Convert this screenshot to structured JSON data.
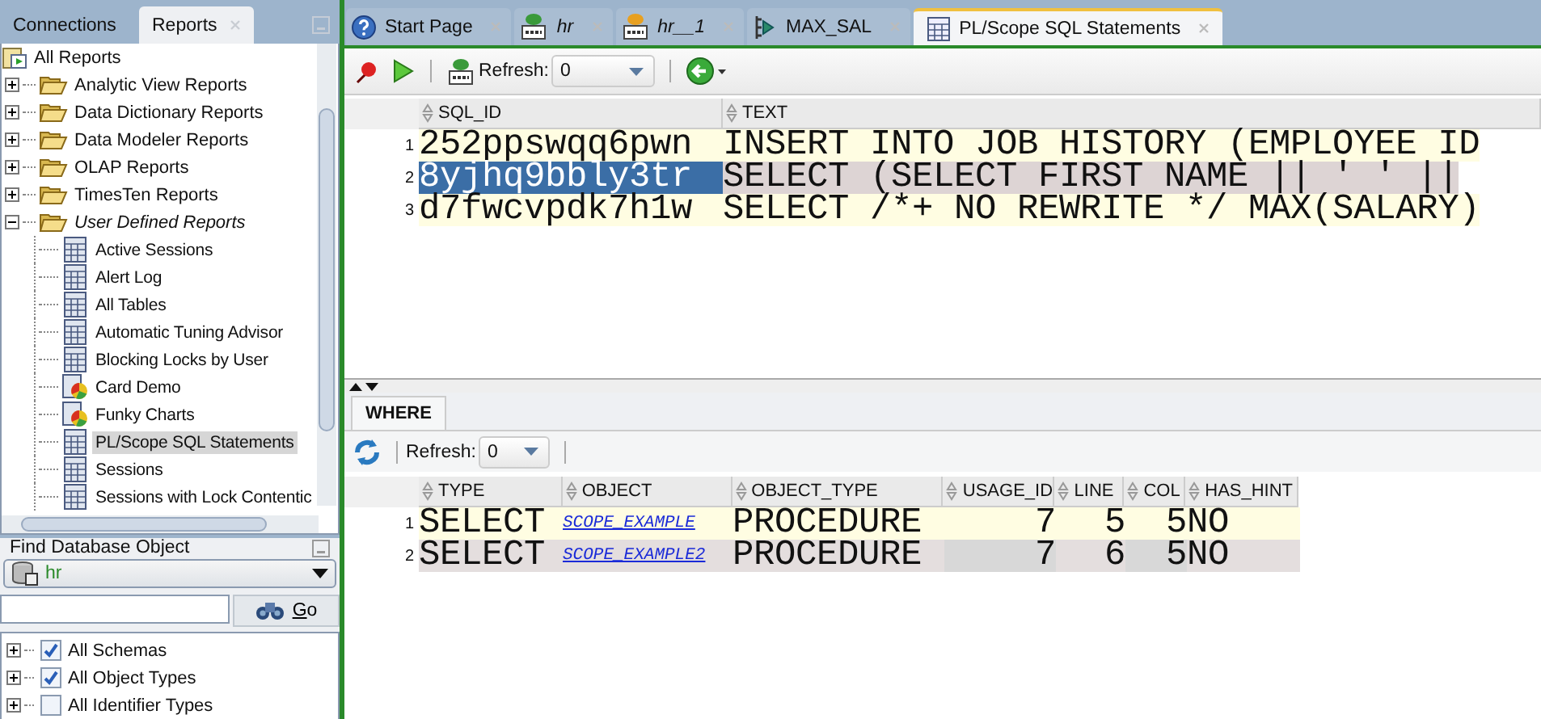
{
  "left_tabs": [
    {
      "label": "Connections",
      "selected": false
    },
    {
      "label": "Reports",
      "selected": true
    }
  ],
  "report_tree": {
    "label": "All Reports",
    "children": [
      {
        "label": "Analytic View Reports",
        "kind": "folder",
        "expanded": false,
        "emphasized": false
      },
      {
        "label": "Data Dictionary Reports",
        "kind": "folder",
        "expanded": false,
        "emphasized": false
      },
      {
        "label": "Data Modeler Reports",
        "kind": "folder",
        "expanded": false,
        "emphasized": false
      },
      {
        "label": "OLAP Reports",
        "kind": "folder",
        "expanded": false,
        "emphasized": false
      },
      {
        "label": "TimesTen Reports",
        "kind": "folder",
        "expanded": false,
        "emphasized": false
      },
      {
        "label": "User Defined Reports",
        "kind": "folder",
        "expanded": true,
        "emphasized": true,
        "children": [
          {
            "label": "Active Sessions",
            "kind": "table",
            "selected": false
          },
          {
            "label": "Alert Log",
            "kind": "table",
            "selected": false
          },
          {
            "label": "All Tables",
            "kind": "table",
            "selected": false
          },
          {
            "label": "Automatic Tuning Advisor",
            "kind": "table",
            "selected": false
          },
          {
            "label": "Blocking Locks by User",
            "kind": "table",
            "selected": false
          },
          {
            "label": "Card Demo",
            "kind": "chart",
            "selected": false
          },
          {
            "label": "Funky Charts",
            "kind": "chart",
            "selected": false
          },
          {
            "label": "PL/Scope SQL Statements",
            "kind": "table",
            "selected": true
          },
          {
            "label": "Sessions",
            "kind": "table",
            "selected": false
          },
          {
            "label": "Sessions with Lock Contentic",
            "kind": "table",
            "selected": false
          }
        ]
      }
    ]
  },
  "find_panel": {
    "title": "Find Database Object",
    "connection": "hr",
    "go_button": "Go",
    "filters": [
      {
        "label": "All Schemas",
        "checked": true
      },
      {
        "label": "All Object Types",
        "checked": true
      },
      {
        "label": "All Identifier Types",
        "checked": false
      }
    ]
  },
  "editor_tabs": [
    {
      "label": "Start Page",
      "kind": "help",
      "italic": false,
      "selected": false
    },
    {
      "label": "hr",
      "kind": "sql",
      "italic": true,
      "selected": false
    },
    {
      "label": "hr__1",
      "kind": "sql-new",
      "italic": true,
      "selected": false
    },
    {
      "label": "MAX_SAL",
      "kind": "procedure",
      "italic": false,
      "selected": false
    },
    {
      "label": "PL/Scope SQL Statements",
      "kind": "report",
      "italic": false,
      "selected": true
    }
  ],
  "toolbar": {
    "refresh_label": "Refresh:",
    "refresh_value": "0"
  },
  "statements": {
    "columns": [
      "SQL_ID",
      "TEXT"
    ],
    "rows": [
      {
        "number": "1",
        "selected": false,
        "cells": [
          "252ppswqq6pwn",
          "INSERT INTO JOB HISTORY (EMPLOYEE ID"
        ]
      },
      {
        "number": "2",
        "selected": true,
        "cells": [
          "8yjhq9bbly3tr",
          "SELECT (SELECT FIRST NAME || ' ' ||"
        ]
      },
      {
        "number": "3",
        "selected": false,
        "cells": [
          "d7fwcvpdk7h1w",
          "SELECT /*+ NO REWRITE */ MAX(SALARY)"
        ]
      }
    ]
  },
  "detail": {
    "tab": "WHERE",
    "refresh_label": "Refresh:",
    "refresh_value": "0",
    "columns": [
      {
        "label": "TYPE",
        "kind": "text"
      },
      {
        "label": "OBJECT",
        "kind": "link"
      },
      {
        "label": "OBJECT_TYPE",
        "kind": "text"
      },
      {
        "label": "USAGE_ID",
        "kind": "number"
      },
      {
        "label": "LINE",
        "kind": "number"
      },
      {
        "label": "COL",
        "kind": "number"
      },
      {
        "label": "HAS_HINT",
        "kind": "text"
      }
    ],
    "rows": [
      {
        "number": "1",
        "cells": [
          "SELECT",
          "SCOPE_EXAMPLE",
          "PROCEDURE",
          "7",
          "5",
          "5",
          "NO"
        ]
      },
      {
        "number": "2",
        "cells": [
          "SELECT",
          "SCOPE_EXAMPLE2",
          "PROCEDURE",
          "7",
          "6",
          "5",
          "NO"
        ]
      }
    ]
  }
}
